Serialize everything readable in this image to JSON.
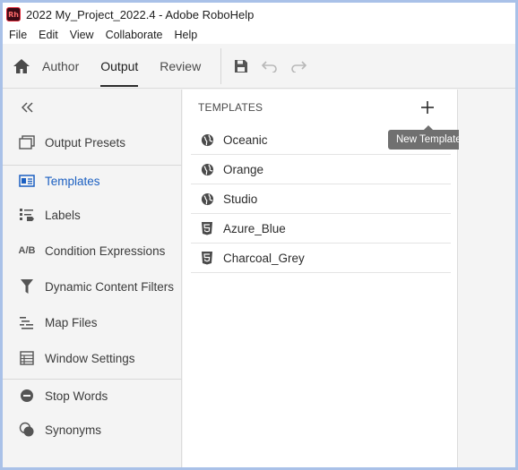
{
  "window": {
    "title": "2022 My_Project_2022.4 - Adobe RoboHelp",
    "logo_text": "Rh"
  },
  "menu": [
    "File",
    "Edit",
    "View",
    "Collaborate",
    "Help"
  ],
  "toolbar": {
    "tabs": [
      {
        "label": "Author",
        "active": false
      },
      {
        "label": "Output",
        "active": true
      },
      {
        "label": "Review",
        "active": false
      }
    ],
    "icons": [
      "home-icon",
      "save-icon",
      "undo-icon",
      "redo-icon"
    ]
  },
  "sidebar": {
    "collapse_icon": "double-chevron-left-icon",
    "items": [
      {
        "label": "Output Presets",
        "icon": "output-presets-icon",
        "selected": false
      },
      {
        "label": "Templates",
        "icon": "templates-icon",
        "selected": true
      },
      {
        "label": "Labels",
        "icon": "labels-icon",
        "selected": false
      },
      {
        "label": "Condition Expressions",
        "icon": "ab-icon",
        "selected": false
      },
      {
        "label": "Dynamic Content Filters",
        "icon": "filter-icon",
        "selected": false
      },
      {
        "label": "Map Files",
        "icon": "map-files-icon",
        "selected": false
      },
      {
        "label": "Window Settings",
        "icon": "window-settings-icon",
        "selected": false
      },
      {
        "label": "Stop Words",
        "icon": "stop-words-icon",
        "selected": false
      },
      {
        "label": "Synonyms",
        "icon": "synonyms-icon",
        "selected": false
      }
    ]
  },
  "templates_panel": {
    "header": "TEMPLATES",
    "add_tooltip": "New Template",
    "items": [
      {
        "name": "Oceanic",
        "icon": "globe-icon"
      },
      {
        "name": "Orange",
        "icon": "globe-icon"
      },
      {
        "name": "Studio",
        "icon": "globe-icon"
      },
      {
        "name": "Azure_Blue",
        "icon": "html5-icon"
      },
      {
        "name": "Charcoal_Grey",
        "icon": "html5-icon"
      }
    ]
  },
  "colors": {
    "accent": "#1b5fc1",
    "window_border": "#a9c1e8",
    "tooltip_bg": "#707070"
  }
}
